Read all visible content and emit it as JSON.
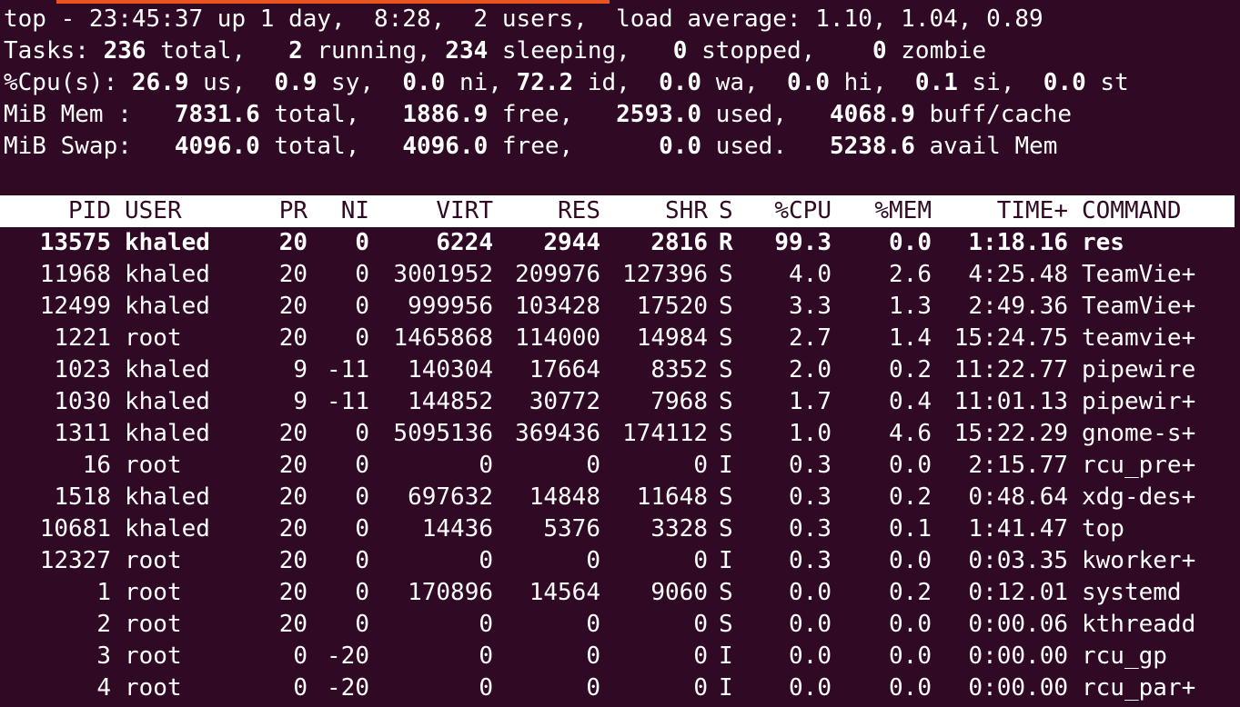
{
  "header": {
    "uptime_line": "top - 23:45:37 up 1 day,  8:28,  2 users,  load average: 1.10, 1.04, 0.89",
    "tasks": {
      "label": "Tasks:",
      "total": "236",
      "total_label": "total,",
      "running": "2",
      "running_label": "running,",
      "sleeping": "234",
      "sleeping_label": "sleeping,",
      "stopped": "0",
      "stopped_label": "stopped,",
      "zombie": "0",
      "zombie_label": "zombie"
    },
    "cpu": {
      "label": "%Cpu(s):",
      "us": "26.9",
      "sy": "0.9",
      "ni": "0.0",
      "id": "72.2",
      "wa": "0.0",
      "hi": "0.0",
      "si": "0.1",
      "st": "0.0"
    },
    "mem": {
      "label": "MiB Mem :",
      "total": "7831.6",
      "free": "1886.9",
      "used": "2593.0",
      "buff_cache": "4068.9"
    },
    "swap": {
      "label": "MiB Swap:",
      "total": "4096.0",
      "free": "4096.0",
      "used": "0.0",
      "avail": "5238.6"
    }
  },
  "table": {
    "columns": [
      "PID",
      "USER",
      "PR",
      "NI",
      "VIRT",
      "RES",
      "SHR",
      "S",
      "%CPU",
      "%MEM",
      "TIME+",
      "COMMAND"
    ],
    "rows": [
      [
        "13575",
        "khaled",
        "20",
        "0",
        "6224",
        "2944",
        "2816",
        "R",
        "99.3",
        "0.0",
        "1:18.16",
        "res"
      ],
      [
        "11968",
        "khaled",
        "20",
        "0",
        "3001952",
        "209976",
        "127396",
        "S",
        "4.0",
        "2.6",
        "4:25.48",
        "TeamVie+"
      ],
      [
        "12499",
        "khaled",
        "20",
        "0",
        "999956",
        "103428",
        "17520",
        "S",
        "3.3",
        "1.3",
        "2:49.36",
        "TeamVie+"
      ],
      [
        "1221",
        "root",
        "20",
        "0",
        "1465868",
        "114000",
        "14984",
        "S",
        "2.7",
        "1.4",
        "15:24.75",
        "teamvie+"
      ],
      [
        "1023",
        "khaled",
        "9",
        "-11",
        "140304",
        "17664",
        "8352",
        "S",
        "2.0",
        "0.2",
        "11:22.77",
        "pipewire"
      ],
      [
        "1030",
        "khaled",
        "9",
        "-11",
        "144852",
        "30772",
        "7968",
        "S",
        "1.7",
        "0.4",
        "11:01.13",
        "pipewir+"
      ],
      [
        "1311",
        "khaled",
        "20",
        "0",
        "5095136",
        "369436",
        "174112",
        "S",
        "1.0",
        "4.6",
        "15:22.29",
        "gnome-s+"
      ],
      [
        "16",
        "root",
        "20",
        "0",
        "0",
        "0",
        "0",
        "I",
        "0.3",
        "0.0",
        "2:15.77",
        "rcu_pre+"
      ],
      [
        "1518",
        "khaled",
        "20",
        "0",
        "697632",
        "14848",
        "11648",
        "S",
        "0.3",
        "0.2",
        "0:48.64",
        "xdg-des+"
      ],
      [
        "10681",
        "khaled",
        "20",
        "0",
        "14436",
        "5376",
        "3328",
        "S",
        "0.3",
        "0.1",
        "1:41.47",
        "top"
      ],
      [
        "12327",
        "root",
        "20",
        "0",
        "0",
        "0",
        "0",
        "I",
        "0.3",
        "0.0",
        "0:03.35",
        "kworker+"
      ],
      [
        "1",
        "root",
        "20",
        "0",
        "170896",
        "14564",
        "9060",
        "S",
        "0.0",
        "0.2",
        "0:12.01",
        "systemd"
      ],
      [
        "2",
        "root",
        "20",
        "0",
        "0",
        "0",
        "0",
        "S",
        "0.0",
        "0.0",
        "0:00.06",
        "kthreadd"
      ],
      [
        "3",
        "root",
        "0",
        "-20",
        "0",
        "0",
        "0",
        "I",
        "0.0",
        "0.0",
        "0:00.00",
        "rcu_gp"
      ],
      [
        "4",
        "root",
        "0",
        "-20",
        "0",
        "0",
        "0",
        "I",
        "0.0",
        "0.0",
        "0:00.00",
        "rcu_par+"
      ]
    ]
  },
  "colors": {
    "background": "#300a24",
    "text": "#ffffff",
    "accent": "#e95420"
  }
}
